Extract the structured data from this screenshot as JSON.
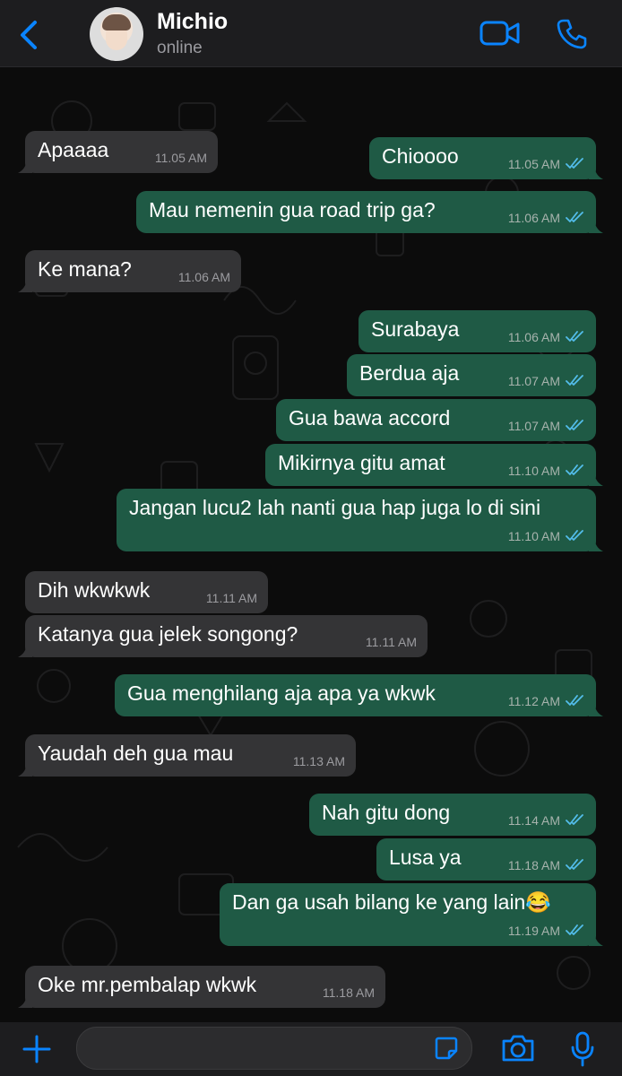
{
  "header": {
    "name": "Michio",
    "status": "online"
  },
  "messages": [
    {
      "dir": "out",
      "text": "Chioooo",
      "time": "11.05 AM"
    },
    {
      "dir": "in",
      "text": "Apaaaa",
      "time": "11.05 AM"
    },
    {
      "dir": "out",
      "text": "Mau nemenin gua road trip ga?",
      "time": "11.06 AM"
    },
    {
      "dir": "in",
      "text": "Ke mana?",
      "time": "11.06 AM"
    },
    {
      "dir": "out",
      "text": "Surabaya",
      "time": "11.06 AM"
    },
    {
      "dir": "out",
      "text": "Berdua aja",
      "time": "11.07 AM"
    },
    {
      "dir": "out",
      "text": "Gua bawa accord",
      "time": "11.07 AM"
    },
    {
      "dir": "out",
      "text": "Mikirnya gitu amat",
      "time": "11.10 AM"
    },
    {
      "dir": "out",
      "text": "Jangan lucu2 lah nanti gua hap juga lo di sini",
      "time": "11.10 AM"
    },
    {
      "dir": "in",
      "text": "Dih wkwkwk",
      "time": "11.11 AM"
    },
    {
      "dir": "in",
      "text": "Katanya gua jelek songong?",
      "time": "11.11 AM"
    },
    {
      "dir": "out",
      "text": "Gua menghilang aja apa ya wkwk",
      "time": "11.12 AM"
    },
    {
      "dir": "in",
      "text": "Yaudah deh gua mau",
      "time": "11.13 AM"
    },
    {
      "dir": "out",
      "text": "Nah gitu dong",
      "time": "11.14 AM"
    },
    {
      "dir": "out",
      "text": "Lusa ya",
      "time": "11.18 AM"
    },
    {
      "dir": "out",
      "text": "Dan ga usah bilang ke yang lain😂",
      "time": "11.19 AM"
    },
    {
      "dir": "in",
      "text": "Oke mr.pembalap wkwk",
      "time": "11.18 AM"
    }
  ],
  "icons": {
    "back": "chevron-left-icon",
    "video": "video-camera-icon",
    "call": "phone-icon",
    "attach": "plus-icon",
    "sticker": "sticker-icon",
    "camera": "camera-icon",
    "mic": "microphone-icon"
  },
  "colors": {
    "accent": "#0a84ff",
    "outgoing": "#1f5a45",
    "incoming": "#343436",
    "read_ticks": "#53bdeb"
  }
}
